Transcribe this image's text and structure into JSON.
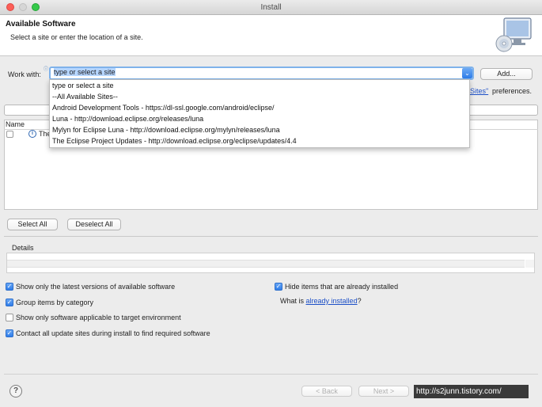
{
  "window": {
    "title": "Install"
  },
  "header": {
    "title": "Available Software",
    "subtitle": "Select a site or enter the location of a site."
  },
  "work_with": {
    "label": "Work with:",
    "value": "type or select a site",
    "add_label": "Add...",
    "sites_link": "Sites\"",
    "sites_suffix": "preferences."
  },
  "dropdown": {
    "items": [
      "type or select a site",
      "--All Available Sites--",
      "Android Development Tools - https://dl-ssl.google.com/android/eclipse/",
      "Luna - http://download.eclipse.org/releases/luna",
      "Mylyn for Eclipse Luna - http://download.eclipse.org/mylyn/releases/luna",
      "The Eclipse Project Updates - http://download.eclipse.org/eclipse/updates/4.4"
    ]
  },
  "table": {
    "column_name": "Name",
    "row_text": "The"
  },
  "buttons": {
    "select_all": "Select All",
    "deselect_all": "Deselect All",
    "back": "< Back",
    "next": "Next >"
  },
  "details": {
    "label": "Details"
  },
  "options": {
    "latest_versions": {
      "label": "Show only the latest versions of available software",
      "checked": true
    },
    "group_by_category": {
      "label": "Group items by category",
      "checked": true
    },
    "target_env": {
      "label": "Show only software applicable to target environment",
      "checked": false
    },
    "contact_sites": {
      "label": "Contact all update sites during install to find required software",
      "checked": true
    },
    "hide_installed": {
      "label": "Hide items that are already installed",
      "checked": true
    },
    "what_is_prefix": "What is",
    "what_is_link": "already installed",
    "what_is_suffix": "?"
  },
  "watermark": "http://s2junn.tistory.com/",
  "colors": {
    "accent": "#2f7de9",
    "link": "#1d50c7"
  }
}
